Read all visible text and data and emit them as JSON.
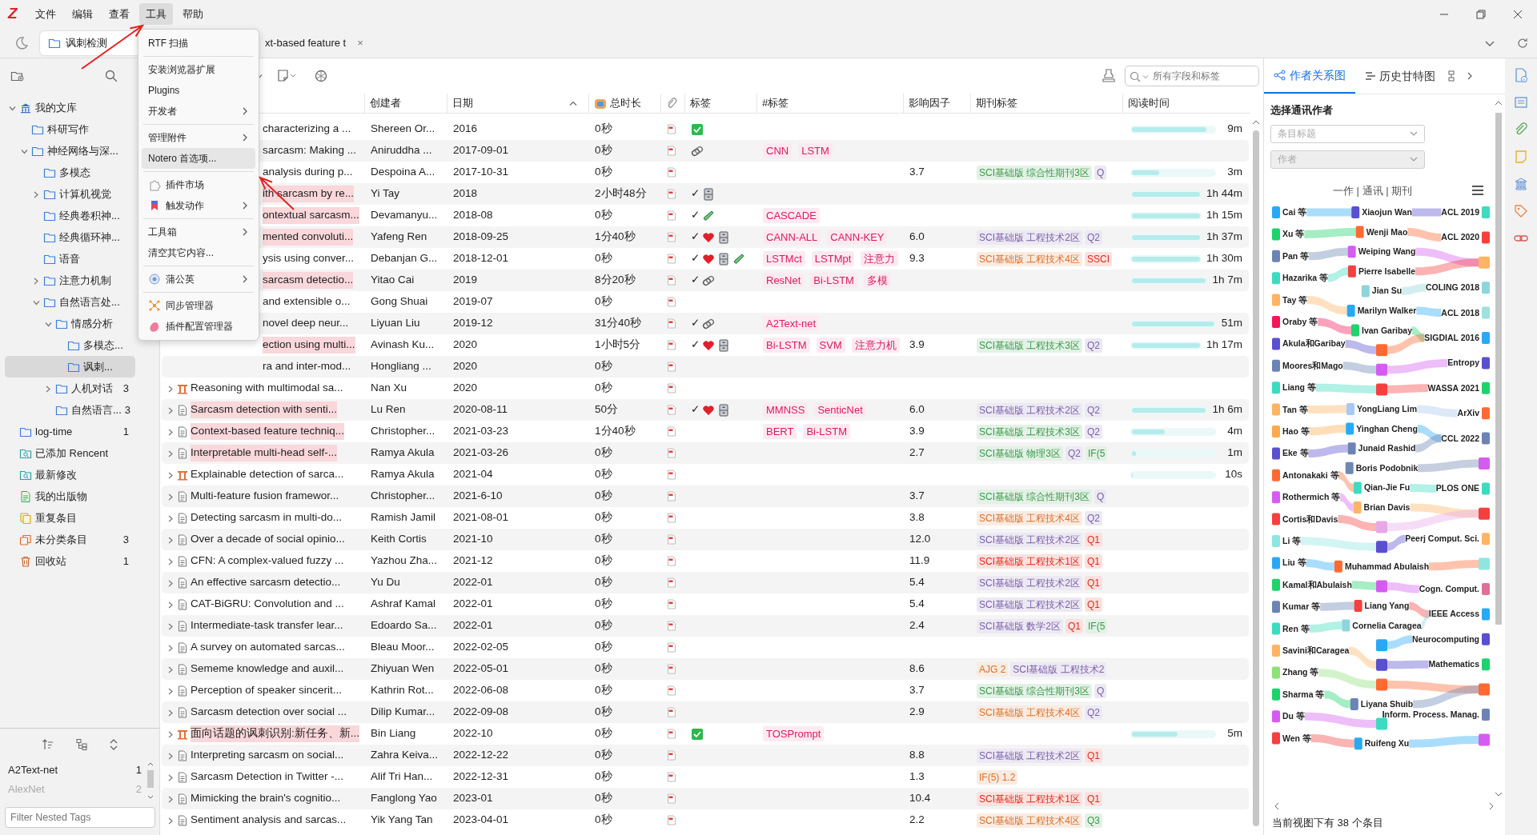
{
  "menu_bar": {
    "logo": "Z",
    "items": [
      {
        "label": "文件",
        "selected": false
      },
      {
        "label": "编辑",
        "selected": false
      },
      {
        "label": "查看",
        "selected": false
      },
      {
        "label": "工具",
        "selected": true
      },
      {
        "label": "帮助",
        "selected": false
      }
    ]
  },
  "tabs": [
    {
      "label": "讽刺检测",
      "selected": true
    },
    {
      "label": "xt-based feature t",
      "selected": false,
      "close": "×"
    }
  ],
  "tools_menu": [
    {
      "kind": "item",
      "label": "RTF 扫描",
      "submenu": false,
      "selected": false
    },
    {
      "kind": "separator"
    },
    {
      "kind": "item",
      "label": "安装浏览器扩展",
      "submenu": false,
      "selected": false
    },
    {
      "kind": "item",
      "label": "Plugins",
      "submenu": false,
      "selected": false
    },
    {
      "kind": "item",
      "label": "开发者",
      "submenu": true,
      "selected": false
    },
    {
      "kind": "separator"
    },
    {
      "kind": "item",
      "label": "管理附件",
      "submenu": true,
      "selected": false
    },
    {
      "kind": "item",
      "label": "Notero 首选项...",
      "submenu": false,
      "selected": true
    },
    {
      "kind": "separator"
    },
    {
      "kind": "icon-item",
      "label": "插件市场",
      "submenu": false,
      "selected": false
    },
    {
      "kind": "icon-item",
      "label": "触发动作",
      "submenu": true,
      "selected": false
    },
    {
      "kind": "separator"
    },
    {
      "kind": "item",
      "label": "工具箱",
      "submenu": true,
      "selected": false
    },
    {
      "kind": "item",
      "label": "清空其它内容...",
      "submenu": false,
      "selected": false
    },
    {
      "kind": "separator"
    },
    {
      "kind": "icon-item",
      "label": "蒲公英",
      "submenu": true,
      "selected": false
    },
    {
      "kind": "separator"
    },
    {
      "kind": "icon-item",
      "label": "同步管理器",
      "submenu": false,
      "selected": false
    },
    {
      "kind": "icon-item",
      "label": "插件配置管理器",
      "submenu": false,
      "selected": false
    }
  ],
  "sidebar": {
    "tree": [
      {
        "label": "我的文库",
        "kind": "library",
        "expanded": true,
        "selected": false,
        "children": [
          {
            "label": "科研写作",
            "kind": "folder",
            "selected": false
          },
          {
            "label": "神经网络与深...",
            "kind": "folder",
            "expanded": true,
            "selected": false,
            "children": [
              {
                "label": "多模态",
                "kind": "folder",
                "selected": false
              },
              {
                "label": "计算机视觉",
                "kind": "folder",
                "expanded": false,
                "selected": false
              },
              {
                "label": "经典卷积神...",
                "kind": "folder",
                "selected": false
              },
              {
                "label": "经典循环神...",
                "kind": "folder",
                "selected": false
              },
              {
                "label": "语音",
                "kind": "folder",
                "selected": false
              },
              {
                "label": "注意力机制",
                "kind": "folder",
                "expanded": false,
                "selected": false
              },
              {
                "label": "自然语言处...",
                "kind": "folder",
                "expanded": true,
                "selected": false,
                "children": [
                  {
                    "label": "情感分析",
                    "kind": "folder",
                    "expanded": true,
                    "selected": false,
                    "children": [
                      {
                        "label": "多模态...",
                        "kind": "folder",
                        "selected": false
                      },
                      {
                        "label": "讽刺...",
                        "kind": "folder",
                        "selected": true
                      }
                    ]
                  },
                  {
                    "label": "人机对话",
                    "kind": "folder",
                    "expanded": false,
                    "selected": false,
                    "count": "3"
                  },
                  {
                    "label": "自然语言...",
                    "kind": "folder",
                    "selected": false,
                    "count": "3"
                  }
                ]
              }
            ]
          }
        ]
      },
      {
        "label": "log-time",
        "kind": "folder",
        "selected": false,
        "count": "1"
      },
      {
        "label": "已添加 Rencent",
        "kind": "saved-search",
        "selected": false
      },
      {
        "label": "最新修改",
        "kind": "saved-search",
        "selected": false
      },
      {
        "label": "我的出版物",
        "kind": "publications",
        "selected": false
      },
      {
        "label": "重复条目",
        "kind": "duplicates",
        "selected": false
      },
      {
        "label": "未分类条目",
        "kind": "unfiled",
        "selected": false,
        "count": "3"
      },
      {
        "label": "回收站",
        "kind": "trash",
        "selected": false,
        "count": "1"
      }
    ],
    "tag_selector": {
      "tags": [
        {
          "label": "A2Text-net",
          "count": "1",
          "disabled": false
        },
        {
          "label": "AlexNet",
          "count": "2",
          "disabled": true
        }
      ],
      "filter": {
        "placeholder": "Filter Nested Tags"
      }
    }
  },
  "search": {
    "placeholder": "所有字段和标签"
  },
  "columns": [
    {
      "kind": "blank"
    },
    {
      "kind": "text",
      "label": "创建者",
      "sorted": false
    },
    {
      "kind": "text",
      "label": "日期",
      "sorted": true
    },
    {
      "kind": "icon-text",
      "label": "总时长",
      "sorted": false
    },
    {
      "kind": "attachment"
    },
    {
      "kind": "text",
      "label": "标签",
      "sorted": false
    },
    {
      "kind": "text",
      "label": "#标签",
      "sorted": false
    },
    {
      "kind": "text",
      "label": "影响因子",
      "sorted": false
    },
    {
      "kind": "text",
      "label": "期刊标签",
      "sorted": false
    },
    {
      "kind": "text",
      "label": "阅读时间",
      "sorted": false
    }
  ],
  "rows": [
    {
      "kind": "covered",
      "title": "characterizing a ...",
      "highlight": false,
      "creator": "Shereen Or...",
      "date": "2016",
      "duration": "0秒",
      "tags": [
        {
          "kind": "check-box"
        }
      ],
      "reading": {
        "level": 0.9,
        "text": "9m"
      }
    },
    {
      "kind": "covered",
      "title": "sarcasm: Making ...",
      "highlight": false,
      "creator": "Aniruddha ...",
      "date": "2017-09-01",
      "duration": "0秒",
      "tags": [
        {
          "kind": "paperclip"
        }
      ],
      "hashtags": [
        "CNN",
        "LSTM"
      ]
    },
    {
      "kind": "covered",
      "title": "analysis during p...",
      "highlight": false,
      "creator": "Despoina A...",
      "date": "2017-10-31",
      "duration": "0秒",
      "impact": "3.7",
      "journal_tags": [
        {
          "text": "SCI基础版 综合性期刊3区",
          "color": "#3a9a4a"
        },
        {
          "text": "Q",
          "color": "#7a5fa8"
        }
      ],
      "reading": {
        "level": 0.33,
        "text": "3m"
      }
    },
    {
      "kind": "covered",
      "title": "ith sarcasm by re...",
      "highlight": true,
      "creator": "Yi Tay",
      "date": "2018",
      "duration": "2小时48分",
      "mark": "✓",
      "tags": [
        {
          "kind": "cabinet"
        }
      ],
      "reading": {
        "level": 1,
        "text": "1h 44m"
      }
    },
    {
      "kind": "covered",
      "title": "ontextual sarcasm...",
      "highlight": true,
      "creator": "Devamanyu...",
      "date": "2018-08",
      "duration": "0秒",
      "mark": "✓",
      "tags": [
        {
          "kind": "tube"
        }
      ],
      "hashtags": [
        "CASCADE"
      ],
      "reading": {
        "level": 1,
        "text": "1h 15m"
      }
    },
    {
      "kind": "covered",
      "title": "mented convoluti...",
      "highlight": true,
      "creator": "Yafeng Ren",
      "date": "2018-09-25",
      "duration": "1分40秒",
      "mark": "✓",
      "tags": [
        {
          "kind": "heart"
        },
        {
          "kind": "cabinet"
        }
      ],
      "hashtags": [
        "CANN-ALL",
        "CANN-KEY"
      ],
      "impact": "6.0",
      "journal_tags": [
        {
          "text": "SCI基础版 工程技术2区",
          "color": "#7a5fa8"
        },
        {
          "text": "Q2",
          "color": "#7a5fa8"
        }
      ],
      "reading": {
        "level": 1,
        "text": "1h 37m"
      }
    },
    {
      "kind": "covered",
      "title": "ysis using conver...",
      "highlight": false,
      "creator": "Debanjan G...",
      "date": "2018-12-01",
      "duration": "0秒",
      "mark": "✓",
      "tags": [
        {
          "kind": "heart"
        },
        {
          "kind": "cabinet"
        },
        {
          "kind": "tube"
        }
      ],
      "hashtags": [
        "LSTMct",
        "LSTMpt",
        "注意力"
      ],
      "impact": "9.3",
      "journal_tags": [
        {
          "text": "SCI基础版 工程技术4区",
          "color": "#d9702a"
        },
        {
          "text": "SSCI",
          "color": "#e02a1a"
        }
      ],
      "reading": {
        "level": 1,
        "text": "1h 30m"
      }
    },
    {
      "kind": "covered",
      "title": "sarcasm detectio...",
      "highlight": true,
      "creator": "Yitao Cai",
      "date": "2019",
      "duration": "8分20秒",
      "mark": "✓",
      "tags": [
        {
          "kind": "paperclip"
        }
      ],
      "hashtags": [
        "ResNet",
        "Bi-LSTM",
        "多模"
      ],
      "reading": {
        "level": 1,
        "text": "1h 7m"
      }
    },
    {
      "kind": "covered",
      "title": "and extensible o...",
      "highlight": false,
      "creator": "Gong Shuai",
      "date": "2019-07",
      "duration": "0秒"
    },
    {
      "kind": "covered",
      "title": "novel deep neur...",
      "highlight": false,
      "creator": "Liyuan Liu",
      "date": "2019-12",
      "duration": "31分40秒",
      "mark": "✓",
      "tags": [
        {
          "kind": "paperclip"
        }
      ],
      "hashtags": [
        "A2Text-net"
      ],
      "reading": {
        "level": 1,
        "text": "51m"
      }
    },
    {
      "kind": "covered",
      "title": "ection using multi...",
      "highlight": true,
      "creator": "Avinash Ku...",
      "date": "2020",
      "duration": "1小时5分",
      "mark": "✓",
      "tags": [
        {
          "kind": "heart"
        },
        {
          "kind": "cabinet"
        }
      ],
      "hashtags": [
        "Bi-LSTM",
        "SVM",
        "注意力机"
      ],
      "impact": "3.9",
      "journal_tags": [
        {
          "text": "SCI基础版 工程技术3区",
          "color": "#3a9a4a"
        },
        {
          "text": "Q2",
          "color": "#7a5fa8"
        }
      ],
      "reading": {
        "level": 1,
        "text": "1h 17m"
      }
    },
    {
      "kind": "covered",
      "title": "ra and inter-mod...",
      "highlight": false,
      "creator": "Hongliang ...",
      "date": "2020",
      "duration": "0秒"
    },
    {
      "kind": "conference",
      "title": "Reasoning with multimodal sa...",
      "highlight": false,
      "creator": "Nan Xu",
      "date": "2020",
      "duration": "0秒"
    },
    {
      "kind": "document",
      "title": "Sarcasm detection with senti...",
      "highlight": true,
      "creator": "Lu Ren",
      "date": "2020-08-11",
      "duration": "50分",
      "mark": "✓",
      "tags": [
        {
          "kind": "heart"
        },
        {
          "kind": "cabinet"
        }
      ],
      "hashtags": [
        "MMNSS",
        "SenticNet"
      ],
      "impact": "6.0",
      "journal_tags": [
        {
          "text": "SCI基础版 工程技术2区",
          "color": "#7a5fa8"
        },
        {
          "text": "Q2",
          "color": "#7a5fa8"
        }
      ],
      "reading": {
        "level": 1,
        "text": "1h 6m"
      }
    },
    {
      "kind": "document",
      "title": "Context-based feature techniq...",
      "highlight": true,
      "creator": "Christopher...",
      "date": "2021-03-23",
      "duration": "1分40秒",
      "hashtags": [
        "BERT",
        "Bi-LSTM"
      ],
      "impact": "3.9",
      "journal_tags": [
        {
          "text": "SCI基础版 工程技术3区",
          "color": "#3a9a4a"
        },
        {
          "text": "Q2",
          "color": "#7a5fa8"
        }
      ],
      "reading": {
        "level": 0.4,
        "text": "4m"
      }
    },
    {
      "kind": "document",
      "title": "Interpretable multi-head self-...",
      "highlight": true,
      "creator": "Ramya Akula",
      "date": "2021-03-26",
      "duration": "0秒",
      "impact": "2.7",
      "journal_tags": [
        {
          "text": "SCI基础版 物理3区",
          "color": "#3a9a4a"
        },
        {
          "text": "Q2",
          "color": "#7a5fa8"
        },
        {
          "text": "IF(5",
          "color": "#3a9a4a"
        }
      ],
      "reading": {
        "level": 0.05,
        "text": "1m"
      }
    },
    {
      "kind": "conference",
      "title": "Explainable detection of sarca...",
      "highlight": false,
      "creator": "Ramya Akula",
      "date": "2021-04",
      "duration": "0秒",
      "reading": {
        "level": 0.01,
        "text": "10s"
      }
    },
    {
      "kind": "document",
      "title": "Multi-feature fusion framewor...",
      "highlight": false,
      "creator": "Christopher...",
      "date": "2021-6-10",
      "duration": "0秒",
      "impact": "3.7",
      "journal_tags": [
        {
          "text": "SCI基础版 综合性期刊3区",
          "color": "#3a9a4a"
        },
        {
          "text": "Q",
          "color": "#7a5fa8"
        }
      ]
    },
    {
      "kind": "document",
      "title": "Detecting sarcasm in multi-do...",
      "highlight": false,
      "creator": "Ramish Jamil",
      "date": "2021-08-01",
      "duration": "0秒",
      "impact": "3.8",
      "journal_tags": [
        {
          "text": "SCI基础版 工程技术4区",
          "color": "#d9702a"
        },
        {
          "text": "Q2",
          "color": "#7a5fa8"
        }
      ]
    },
    {
      "kind": "document",
      "title": "Over a decade of social opinio...",
      "highlight": false,
      "creator": "Keith Cortis",
      "date": "2021-10",
      "duration": "0秒",
      "impact": "12.0",
      "journal_tags": [
        {
          "text": "SCI基础版 工程技术2区",
          "color": "#7a5fa8"
        },
        {
          "text": "Q1",
          "color": "#e02a1a"
        }
      ]
    },
    {
      "kind": "document",
      "title": "CFN: A complex-valued fuzzy ...",
      "highlight": false,
      "creator": "Yazhou Zha...",
      "date": "2021-12",
      "duration": "0秒",
      "impact": "11.9",
      "journal_tags": [
        {
          "text": "SCI基础版 工程技术1区",
          "color": "#e02a1a"
        },
        {
          "text": "Q1",
          "color": "#e02a1a"
        }
      ]
    },
    {
      "kind": "document",
      "title": "An effective sarcasm detectio...",
      "highlight": false,
      "creator": "Yu Du",
      "date": "2022-01",
      "duration": "0秒",
      "impact": "5.4",
      "journal_tags": [
        {
          "text": "SCI基础版 工程技术2区",
          "color": "#7a5fa8"
        },
        {
          "text": "Q1",
          "color": "#e02a1a"
        }
      ]
    },
    {
      "kind": "document",
      "title": "CAT-BiGRU: Convolution and ...",
      "highlight": false,
      "creator": "Ashraf Kamal",
      "date": "2022-01",
      "duration": "0秒",
      "impact": "5.4",
      "journal_tags": [
        {
          "text": "SCI基础版 工程技术2区",
          "color": "#7a5fa8"
        },
        {
          "text": "Q1",
          "color": "#e02a1a"
        }
      ]
    },
    {
      "kind": "document",
      "title": "Intermediate-task transfer lear...",
      "highlight": false,
      "creator": "Edoardo Sa...",
      "date": "2022-01",
      "duration": "0秒",
      "impact": "2.4",
      "journal_tags": [
        {
          "text": "SCI基础版 数学2区",
          "color": "#7a5fa8"
        },
        {
          "text": "Q1",
          "color": "#e02a1a"
        },
        {
          "text": "IF(5",
          "color": "#3a9a4a"
        }
      ]
    },
    {
      "kind": "document",
      "title": "A survey on automated sarcas...",
      "highlight": false,
      "creator": "Bleau Moor...",
      "date": "2022-02-05",
      "duration": "0秒"
    },
    {
      "kind": "document",
      "title": "Sememe knowledge and auxil...",
      "highlight": false,
      "creator": "Zhiyuan Wen",
      "date": "2022-05-01",
      "duration": "0秒",
      "impact": "8.6",
      "journal_tags": [
        {
          "text": "AJG 2",
          "color": "#d9702a"
        },
        {
          "text": "SCI基础版 工程技术2",
          "color": "#7a5fa8"
        }
      ]
    },
    {
      "kind": "document",
      "title": "Perception of speaker sincerit...",
      "highlight": false,
      "creator": "Kathrin Rot...",
      "date": "2022-06-08",
      "duration": "0秒",
      "impact": "3.7",
      "journal_tags": [
        {
          "text": "SCI基础版 综合性期刊3区",
          "color": "#3a9a4a"
        },
        {
          "text": "Q",
          "color": "#7a5fa8"
        }
      ]
    },
    {
      "kind": "document",
      "title": "Sarcasm detection over social ...",
      "highlight": false,
      "creator": "Dilip Kumar...",
      "date": "2022-09-08",
      "duration": "0秒",
      "impact": "2.9",
      "journal_tags": [
        {
          "text": "SCI基础版 工程技术4区",
          "color": "#d9702a"
        },
        {
          "text": "Q2",
          "color": "#7a5fa8"
        }
      ]
    },
    {
      "kind": "conference",
      "title": "面向话题的讽刺识别:新任务、新...",
      "highlight": true,
      "creator": "Bin Liang",
      "date": "2022-10",
      "duration": "0秒",
      "tags": [
        {
          "kind": "check-box"
        }
      ],
      "hashtags": [
        "TOSPrompt"
      ],
      "reading": {
        "level": 0.55,
        "text": "5m"
      }
    },
    {
      "kind": "document",
      "title": "Interpreting sarcasm on social...",
      "highlight": false,
      "creator": "Zahra Keiva...",
      "date": "2022-12-22",
      "duration": "0秒",
      "impact": "8.8",
      "journal_tags": [
        {
          "text": "SCI基础版 工程技术2区",
          "color": "#7a5fa8"
        },
        {
          "text": "Q1",
          "color": "#e02a1a"
        }
      ]
    },
    {
      "kind": "document",
      "title": "Sarcasm Detection in Twitter -...",
      "highlight": false,
      "creator": "Alif Tri Han...",
      "date": "2022-12-31",
      "duration": "0秒",
      "impact": "1.3",
      "journal_tags": [
        {
          "text": "IF(5) 1.2",
          "color": "#d9702a"
        }
      ]
    },
    {
      "kind": "document",
      "title": "Mimicking the brain's cognitio...",
      "highlight": false,
      "creator": "Fanglong Yao",
      "date": "2023-01",
      "duration": "0秒",
      "impact": "10.4",
      "journal_tags": [
        {
          "text": "SCI基础版 工程技术1区",
          "color": "#e02a1a"
        },
        {
          "text": "Q1",
          "color": "#e02a1a"
        }
      ]
    },
    {
      "kind": "document",
      "title": "Sentiment analysis and sarcas...",
      "highlight": false,
      "creator": "Yik Yang Tan",
      "date": "2023-04-01",
      "duration": "0秒",
      "impact": "2.2",
      "journal_tags": [
        {
          "text": "SCI基础版 工程技术4区",
          "color": "#d9702a"
        },
        {
          "text": "Q3",
          "color": "#3a9a4a"
        }
      ]
    }
  ],
  "right_pane": {
    "tabs": [
      {
        "label": "作者关系图",
        "selected": true
      },
      {
        "label": "历史甘特图",
        "selected": false
      }
    ],
    "picker_label": "选择通讯作者",
    "selects": [
      {
        "placeholder": "条目标题",
        "disabled": false
      },
      {
        "placeholder": "作者",
        "disabled": true
      }
    ],
    "chart_title": "一作 | 通讯 | 期刊",
    "sankey": {
      "first": [
        {
          "label": "Cai 等",
          "color": "#29a9f5"
        },
        {
          "label": "Xu 等",
          "color": "#1dd36b"
        },
        {
          "label": "Pan 等",
          "color": "#6c84b4"
        },
        {
          "label": "Hazarika 等",
          "color": "#3ddbc0"
        },
        {
          "label": "Tay 等",
          "color": "#ffb463"
        },
        {
          "label": "Oraby 等",
          "color": "#f5165a"
        },
        {
          "label": "Akula和Garibay",
          "color": "#5a4fcf"
        },
        {
          "label": "Moores和Mago",
          "color": "#6c84b4"
        },
        {
          "label": "Liang 等",
          "color": "#3ddbc0"
        },
        {
          "label": "Tan 等",
          "color": "#ffb463"
        },
        {
          "label": "Hao 等",
          "color": "#ffa94d"
        },
        {
          "label": "Eke 等",
          "color": "#5a4fcf"
        },
        {
          "label": "Antonakaki 等",
          "color": "#ff6a33"
        },
        {
          "label": "Rothermich 等",
          "color": "#d55cf0"
        },
        {
          "label": "Cortis和Davis",
          "color": "#f54040"
        },
        {
          "label": "Li 等",
          "color": "#8fe6e0"
        },
        {
          "label": "Liu 等",
          "color": "#29a9f5"
        },
        {
          "label": "Kamal和Abulaish",
          "color": "#1dd36b"
        },
        {
          "label": "Kumar 等",
          "color": "#6c84b4"
        },
        {
          "label": "Ren 等",
          "color": "#3ddbc0"
        },
        {
          "label": "Savini和Caragea",
          "color": "#ffb463"
        },
        {
          "label": "Zhang 等",
          "color": "#8fe07a"
        },
        {
          "label": "Sharma 等",
          "color": "#1dd36b"
        },
        {
          "label": "Du 等",
          "color": "#d55cf0"
        },
        {
          "label": "Wen 等",
          "color": "#f54040"
        }
      ],
      "corresponding": [
        {
          "label": "Xiaojun Wan",
          "color": "#5a4fcf"
        },
        {
          "label": "Wenji Mao",
          "color": "#ff6a33"
        },
        {
          "label": "Weiping Wang",
          "color": "#d55cf0"
        },
        {
          "label": "Pierre Isabelle",
          "color": "#f54040"
        },
        {
          "label": "Jian Su",
          "color": "#8fd4dc"
        },
        {
          "label": "Marilyn Walker",
          "color": "#29a9f5"
        },
        {
          "label": "Ivan Garibay",
          "color": "#1dd36b"
        },
        {
          "color": "#ff6a33"
        },
        {
          "color": "#d55cf0"
        },
        {
          "color": "#f54040"
        },
        {
          "label": "YongLiang Lim",
          "color": "#a8c8f0"
        },
        {
          "label": "Yinghan Cheng",
          "color": "#29a9f5"
        },
        {
          "label": "Junaid Rashid",
          "color": "#6c84b4"
        },
        {
          "label": "Boris Podobnik",
          "color": "#7088b0"
        },
        {
          "label": "Qian-Jie Fu",
          "color": "#3ddbc0"
        },
        {
          "label": "Brian Davis",
          "color": "#ffb463"
        },
        {
          "color": "#e8a8e8"
        },
        {
          "color": "#5a4fcf"
        },
        {
          "label": "Muhammad Abulaish",
          "color": "#ff6a33"
        },
        {
          "color": "#d55cf0"
        },
        {
          "label": "Liang Yang",
          "color": "#f54040"
        },
        {
          "label": "Cornelia Caragea",
          "color": "#8fd4dc"
        },
        {
          "color": "#29a9f5"
        },
        {
          "color": "#5a4fcf"
        },
        {
          "color": "#ff6a33"
        },
        {
          "label": "Liyana Shuib",
          "color": "#6c84b4"
        },
        {
          "color": "#3ddbc0"
        },
        {
          "label": "Ruifeng Xu",
          "color": "#29a9f5"
        }
      ],
      "journal": [
        {
          "label": "ACL 2019",
          "color": "#3ddbc0"
        },
        {
          "label": "ACL 2020",
          "color": "#f54040"
        },
        {
          "color": "#ffb463"
        },
        {
          "label": "COLING 2018",
          "color": "#8fd4dc"
        },
        {
          "label": "ACL 2018",
          "color": "#9fe0e0"
        },
        {
          "label": "SIGDIAL 2016",
          "color": "#29a9f5"
        },
        {
          "label": "Entropy",
          "color": "#5a4fcf"
        },
        {
          "label": "WASSA 2021",
          "color": "#1dd36b"
        },
        {
          "label": "ArXiv",
          "color": "#ff6a33"
        },
        {
          "label": "CCL 2022",
          "color": "#6c84b4"
        },
        {
          "color": "#d55cf0"
        },
        {
          "label": "PLOS ONE",
          "color": "#3ddbc0"
        },
        {
          "color": "#f54040"
        },
        {
          "label": "Peerj Comput. Sci.",
          "color": "#ffb463"
        },
        {
          "color": "#8fe6e0"
        },
        {
          "label": "Cogn. Comput.",
          "color": "#e0709a"
        },
        {
          "label": "IEEE Access",
          "color": "#29a9f5"
        },
        {
          "label": "Neurocomputing",
          "color": "#5a4fcf"
        },
        {
          "label": "Mathematics",
          "color": "#1dd36b"
        },
        {
          "color": "#ff6a33"
        },
        {
          "label": "Inform. Process. Manag.",
          "color": "#6c84b4"
        },
        {
          "color": "#d55cf0"
        }
      ]
    },
    "footer": "当前视图下有 38 个条目"
  }
}
